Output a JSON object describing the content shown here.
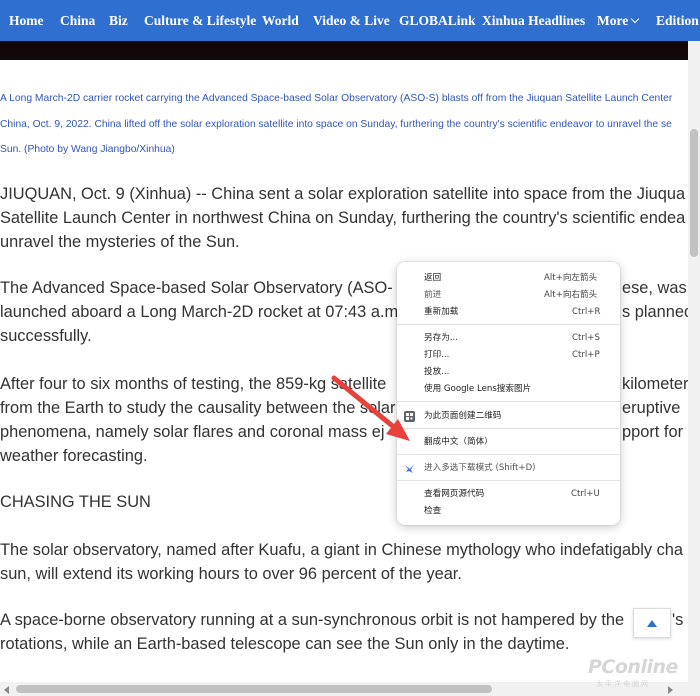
{
  "nav": {
    "items": [
      "Home",
      "China",
      "Biz",
      "Culture & Lifestyle",
      "World",
      "Video & Live",
      "GLOBALink",
      "Xinhua Headlines",
      "More",
      "Edition"
    ]
  },
  "caption": {
    "lines": [
      "A Long March-2D carrier rocket carrying the Advanced Space-based Solar Observatory (ASO-S) blasts off from the Jiuquan Satellite Launch Center",
      "China, Oct. 9, 2022. China lifted off the solar exploration satellite into space on Sunday, furthering the country's scientific endeavor to unravel the se",
      "Sun. (Photo by Wang Jiangbo/Xinhua)"
    ]
  },
  "article": {
    "p1": [
      "JIUQUAN, Oct. 9 (Xinhua) -- China sent a solar exploration satellite into space from the Jiuqua",
      "Satellite Launch Center in northwest China on Sunday, furthering the country's scientific endea",
      "unravel the mysteries of the Sun."
    ],
    "p2": [
      "The Advanced Space-based Solar Observatory (ASO-",
      "launched aboard a Long March-2D rocket at 07:43 a.m",
      "successfully."
    ],
    "p2_right": [
      "ese, was",
      "s planned"
    ],
    "p3": [
      "After four to six months of testing, the 859-kg satellite",
      "from the Earth to study the causality between the solar",
      "phenomena, namely solar flares and coronal mass ej",
      "weather forecasting."
    ],
    "p3_right": [
      "kilometer",
      "eruptive",
      "pport for s"
    ],
    "heading": "CHASING THE SUN",
    "p4": [
      "The solar observatory, named after Kuafu, a giant in Chinese mythology who indefatigably cha",
      "sun, will extend its working hours to over 96 percent of the year."
    ],
    "p5": [
      "A space-borne observatory running at a sun-synchronous orbit is not hampered by the",
      "rotations, while an Earth-based telescope can see the Sun only in the daytime."
    ],
    "p5_right": "'s"
  },
  "context_menu": {
    "groups": [
      [
        {
          "label": "返回",
          "shortcut": "Alt+向左箭头"
        },
        {
          "label": "前进",
          "shortcut": "Alt+向右箭头"
        },
        {
          "label": "重新加载",
          "shortcut": "Ctrl+R"
        }
      ],
      [
        {
          "label": "另存为...",
          "shortcut": "Ctrl+S"
        },
        {
          "label": "打印...",
          "shortcut": "Ctrl+P"
        },
        {
          "label": "投放...",
          "shortcut": ""
        },
        {
          "label": "使用 Google Lens搜索图片",
          "shortcut": ""
        }
      ],
      [
        {
          "label": "为此页面创建二维码",
          "shortcut": "",
          "icon": "qr-code-icon"
        }
      ],
      [
        {
          "label": "翻成中文（简体）",
          "shortcut": ""
        }
      ],
      [
        {
          "label": "进入多选下载模式 (Shift+D)",
          "shortcut": "",
          "icon": "bird-extension-icon"
        }
      ],
      [
        {
          "label": "查看网页源代码",
          "shortcut": "Ctrl+U"
        },
        {
          "label": "检查",
          "shortcut": ""
        }
      ]
    ]
  },
  "colors": {
    "nav_bg": "#2f6fd0",
    "caption": "#3056b8",
    "arrow": "#e8403a"
  },
  "watermark": {
    "brand": "PConline",
    "sub": "太平洋电脑网"
  }
}
